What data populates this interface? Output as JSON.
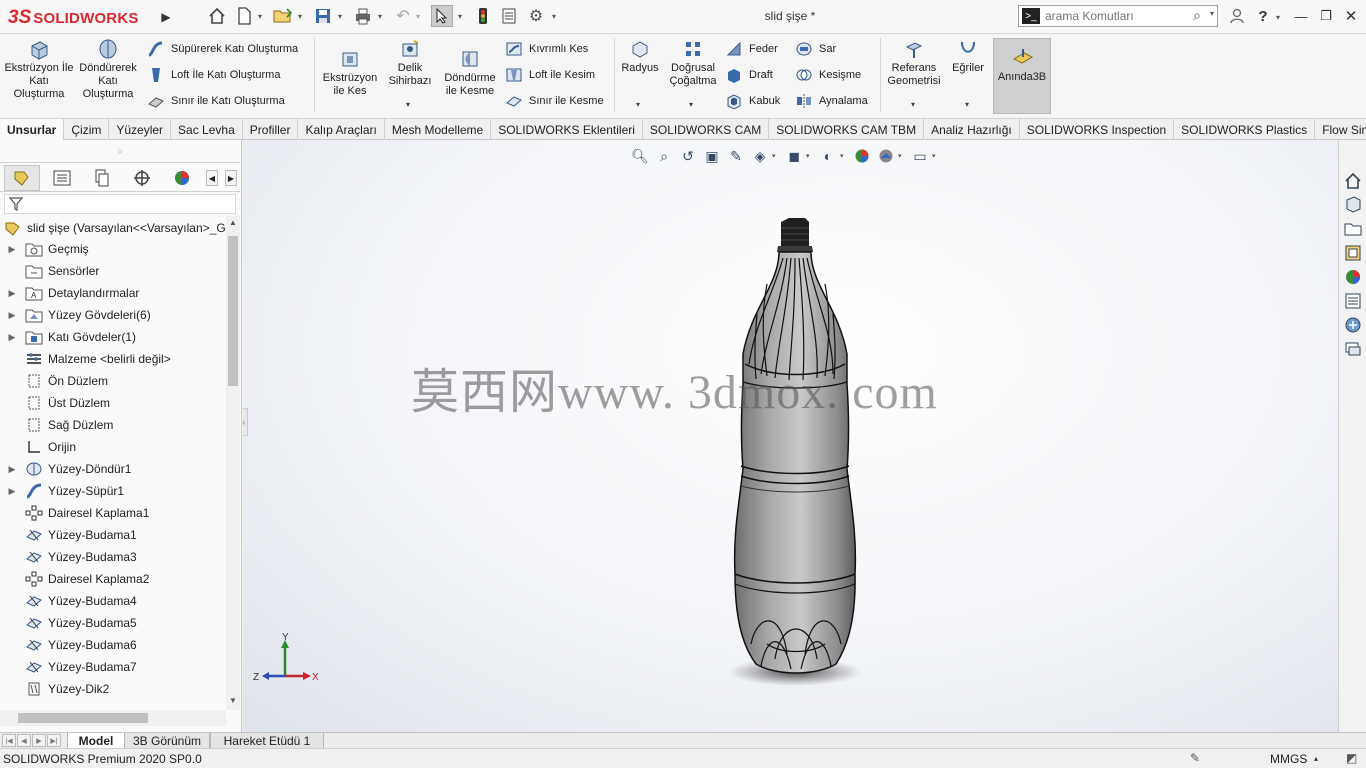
{
  "app": {
    "brand_prefix": "3S",
    "brand_name": "SOLIDWORKS",
    "document_title": "slid şişe *"
  },
  "search": {
    "placeholder": "arama Komutları"
  },
  "ribbon": {
    "extruded_boss": "Ekstrüzyon İle Katı Oluşturma",
    "revolved_boss": "Döndürerek Katı Oluşturma",
    "swept_boss": "Süpürerek Katı Oluşturma",
    "lofted_boss": "Loft İle Katı Oluşturma",
    "boundary_boss": "Sınır ile Katı Oluşturma",
    "extruded_cut": "Ekstrüzyon ile Kes",
    "hole_wizard": "Delik Sihirbazı",
    "revolved_cut": "Döndürme ile Kesme",
    "swept_cut": "Kıvrımlı Kes",
    "lofted_cut": "Loft ile Kesim",
    "boundary_cut": "Sınır ile Kesme",
    "fillet": "Radyus",
    "linear_pattern": "Doğrusal Çoğaltma",
    "rib": "Feder",
    "draft": "Draft",
    "shell": "Kabuk",
    "wrap": "Sar",
    "intersect": "Kesişme",
    "mirror": "Aynalama",
    "reference_geometry": "Referans Geometrisi",
    "curves": "Eğriler",
    "instant3d": "Anında3B"
  },
  "cm_tabs": [
    {
      "label": "Unsurlar",
      "active": true
    },
    {
      "label": "Çizim"
    },
    {
      "label": "Yüzeyler"
    },
    {
      "label": "Sac Levha"
    },
    {
      "label": "Profiller"
    },
    {
      "label": "Kalıp Araçları"
    },
    {
      "label": "Mesh Modelleme"
    },
    {
      "label": "SOLIDWORKS Eklentileri"
    },
    {
      "label": "SOLIDWORKS CAM"
    },
    {
      "label": "SOLIDWORKS CAM TBM"
    },
    {
      "label": "Analiz Hazırlığı"
    },
    {
      "label": "SOLIDWORKS Inspection"
    },
    {
      "label": "SOLIDWORKS Plastics"
    },
    {
      "label": "Flow Simulation"
    }
  ],
  "tree": {
    "root": "slid şişe  (Varsayılan<<Varsayılan>_Gö",
    "items": [
      {
        "label": "Geçmiş",
        "expandable": true,
        "icon": "history-folder-icon"
      },
      {
        "label": "Sensörler",
        "expandable": false,
        "icon": "sensor-folder-icon"
      },
      {
        "label": "Detaylandırmalar",
        "expandable": true,
        "icon": "annotations-icon"
      },
      {
        "label": "Yüzey Gövdeleri(6)",
        "expandable": true,
        "icon": "surface-bodies-icon"
      },
      {
        "label": "Katı Gövdeler(1)",
        "expandable": true,
        "icon": "solid-bodies-icon"
      },
      {
        "label": "Malzeme <belirli değil>",
        "expandable": false,
        "icon": "material-icon"
      },
      {
        "label": "Ön Düzlem",
        "expandable": false,
        "icon": "plane-icon"
      },
      {
        "label": "Üst Düzlem",
        "expandable": false,
        "icon": "plane-icon"
      },
      {
        "label": "Sağ Düzlem",
        "expandable": false,
        "icon": "plane-icon"
      },
      {
        "label": "Orijin",
        "expandable": false,
        "icon": "origin-icon"
      },
      {
        "label": "Yüzey-Döndür1",
        "expandable": true,
        "icon": "surface-revolve-icon"
      },
      {
        "label": "Yüzey-Süpür1",
        "expandable": true,
        "icon": "surface-sweep-icon"
      },
      {
        "label": "Dairesel Kaplama1",
        "expandable": false,
        "icon": "circular-pattern-icon"
      },
      {
        "label": "Yüzey-Budama1",
        "expandable": false,
        "icon": "surface-trim-icon"
      },
      {
        "label": "Yüzey-Budama3",
        "expandable": false,
        "icon": "surface-trim-icon"
      },
      {
        "label": "Dairesel Kaplama2",
        "expandable": false,
        "icon": "circular-pattern-icon"
      },
      {
        "label": "Yüzey-Budama4",
        "expandable": false,
        "icon": "surface-trim-icon"
      },
      {
        "label": "Yüzey-Budama5",
        "expandable": false,
        "icon": "surface-trim-icon"
      },
      {
        "label": "Yüzey-Budama6",
        "expandable": false,
        "icon": "surface-trim-icon"
      },
      {
        "label": "Yüzey-Budama7",
        "expandable": false,
        "icon": "surface-trim-icon"
      },
      {
        "label": "Yüzey-Dik2",
        "expandable": false,
        "icon": "surface-ruled-icon"
      }
    ]
  },
  "graphics": {
    "watermark": "莫西网www. 3dmox. com",
    "triad": {
      "x": "X",
      "y": "Y",
      "z": "Z"
    }
  },
  "bottom_tabs": [
    {
      "label": "Model",
      "active": true
    },
    {
      "label": "3B Görünüm"
    },
    {
      "label": "Hareket Etüdü 1"
    }
  ],
  "status": {
    "text": "SOLIDWORKS Premium 2020 SP0.0",
    "units": "MMGS"
  },
  "colors": {
    "brand_red": "#d8282f",
    "active_tool_bg": "#cfcfcf",
    "icon_blue": "#3a6aa8"
  }
}
